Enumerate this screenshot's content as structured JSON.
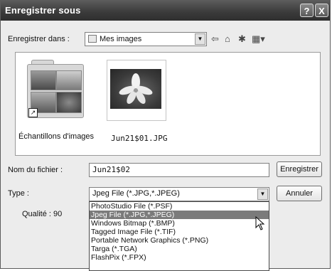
{
  "dialog": {
    "title": "Enregistrer sous",
    "help_label": "?",
    "close_label": "X"
  },
  "save_in": {
    "label": "Enregistrer dans :",
    "value": "Mes images"
  },
  "toolbar": {
    "icons": [
      "back-arrow-icon",
      "up-folder-icon",
      "new-folder-icon",
      "view-menu-icon"
    ]
  },
  "files": [
    {
      "name": "Échantillons d'images",
      "type": "folder-shortcut"
    },
    {
      "name": "Jun21$01.JPG",
      "type": "image"
    }
  ],
  "filename": {
    "label": "Nom du fichier :",
    "value": "Jun21$02"
  },
  "filetype": {
    "label": "Type :",
    "value": "Jpeg File (*.JPG,*.JPEG)",
    "options": [
      {
        "label": "PhotoStudio File (*.PSF)",
        "selected": false
      },
      {
        "label": "Jpeg File (*.JPG,*.JPEG)",
        "selected": true
      },
      {
        "label": "Windows Bitmap (*.BMP)",
        "selected": false
      },
      {
        "label": "Tagged Image File (*.TIF)",
        "selected": false
      },
      {
        "label": "Portable Network Graphics (*.PNG)",
        "selected": false
      },
      {
        "label": "Targa (*.TGA)",
        "selected": false
      },
      {
        "label": "FlashPix (*.FPX)",
        "selected": false
      }
    ]
  },
  "quality": {
    "label": "Qualité : 90"
  },
  "buttons": {
    "save": "Enregistrer",
    "cancel": "Annuler"
  }
}
